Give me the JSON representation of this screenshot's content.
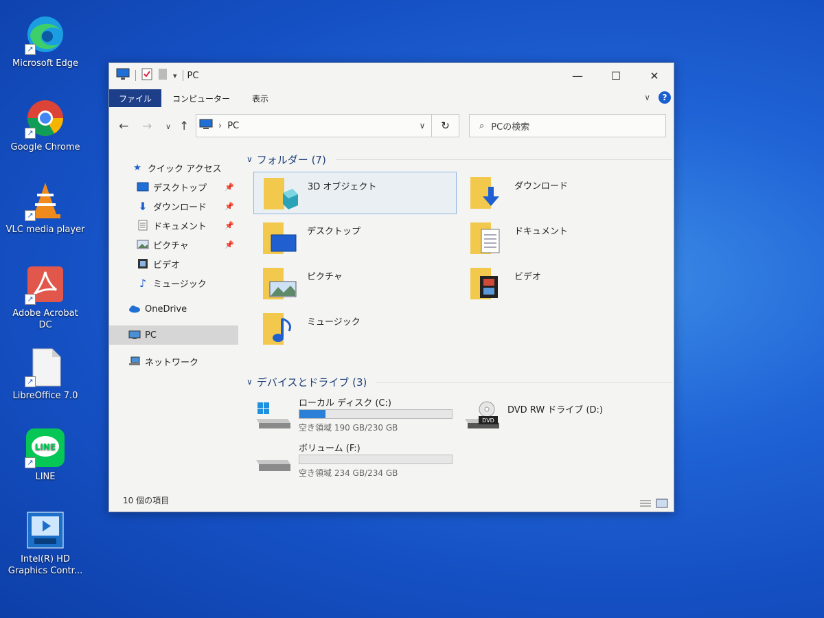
{
  "desktop": {
    "icons": [
      {
        "label": "Microsoft Edge",
        "icon": "edge-icon"
      },
      {
        "label": "Google Chrome",
        "icon": "chrome-icon"
      },
      {
        "label": "VLC media player",
        "icon": "vlc-icon"
      },
      {
        "label": "Adobe Acrobat DC",
        "icon": "acrobat-icon"
      },
      {
        "label": "LibreOffice 7.0",
        "icon": "libreoffice-icon"
      },
      {
        "label": "LINE",
        "icon": "line-icon"
      },
      {
        "label": "Intel(R) HD Graphics Contr...",
        "icon": "intel-graphics-icon"
      }
    ],
    "line_logo_text": "LINE",
    "shortcut_glyph": "↗"
  },
  "window": {
    "title": "PC",
    "ribbon_tabs": [
      "ファイル",
      "コンピューター",
      "表示"
    ],
    "address": "PC",
    "search_placeholder": "PCの検索",
    "nav": {
      "quick_access": "クイック アクセス",
      "items": [
        {
          "label": "デスクトップ",
          "pinned": true
        },
        {
          "label": "ダウンロード",
          "pinned": true
        },
        {
          "label": "ドキュメント",
          "pinned": true
        },
        {
          "label": "ピクチャ",
          "pinned": true
        },
        {
          "label": "ビデオ",
          "pinned": false
        },
        {
          "label": "ミュージック",
          "pinned": false
        }
      ],
      "onedrive": "OneDrive",
      "pc": "PC",
      "network": "ネットワーク"
    },
    "folders_header": "フォルダー (7)",
    "folders": [
      {
        "label": "3D オブジェクト",
        "icon": "3d-objects-folder-icon"
      },
      {
        "label": "ダウンロード",
        "icon": "downloads-folder-icon"
      },
      {
        "label": "デスクトップ",
        "icon": "desktop-folder-icon"
      },
      {
        "label": "ドキュメント",
        "icon": "documents-folder-icon"
      },
      {
        "label": "ピクチャ",
        "icon": "pictures-folder-icon"
      },
      {
        "label": "ビデオ",
        "icon": "videos-folder-icon"
      },
      {
        "label": "ミュージック",
        "icon": "music-folder-icon"
      }
    ],
    "devices_header": "デバイスとドライブ (3)",
    "drives": [
      {
        "label": "ローカル ディスク (C:)",
        "free": "空き領域 190 GB/230 GB",
        "used_fraction": 0.17,
        "icon": "windows-drive-icon"
      },
      {
        "label": "DVD RW ドライブ (D:)",
        "icon": "dvd-drive-icon",
        "dvd_badge": "DVD"
      },
      {
        "label": "ボリューム (F:)",
        "free": "空き領域 234 GB/234 GB",
        "used_fraction": 0.0,
        "icon": "drive-icon"
      }
    ],
    "status": "10 個の項目",
    "colors": {
      "accent": "#1d3f8a",
      "folder": "#f2c94c",
      "progress": "#2a7fd6"
    }
  }
}
